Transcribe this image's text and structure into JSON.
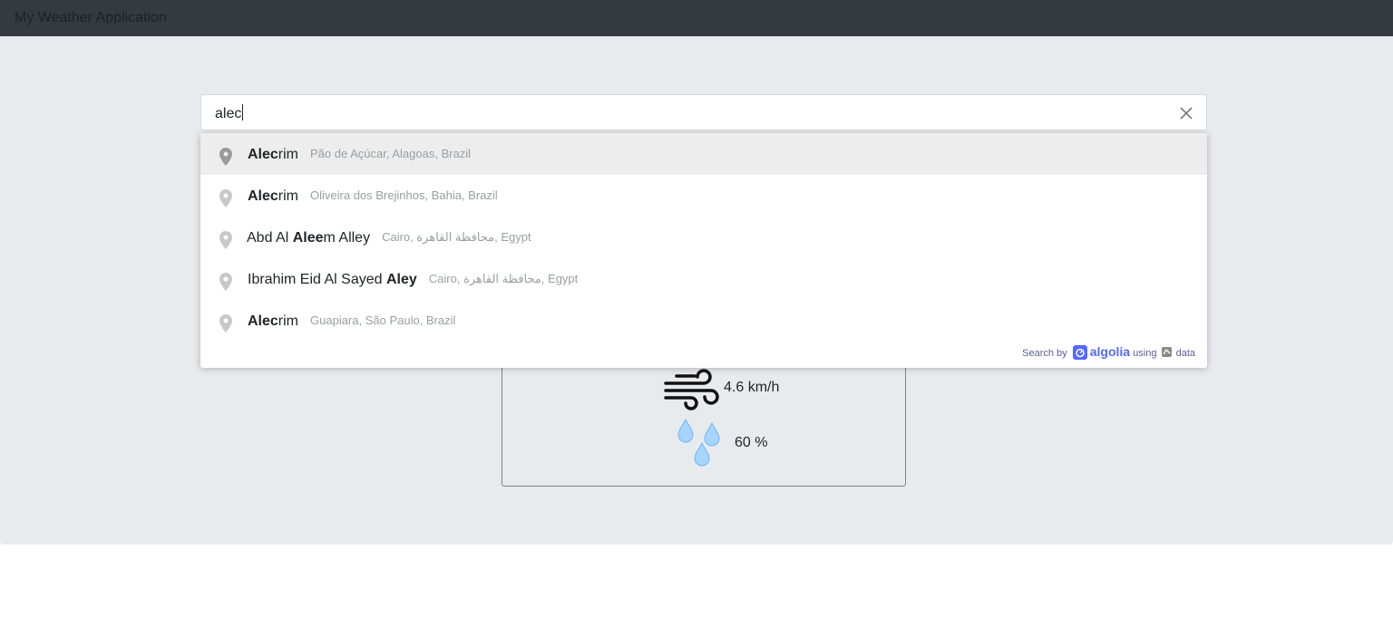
{
  "app": {
    "title": "My Weather Application"
  },
  "search": {
    "value": "alec"
  },
  "suggestions": [
    {
      "name_parts": [
        {
          "text": "Alec",
          "bold": true
        },
        {
          "text": "rim",
          "bold": false
        }
      ],
      "address": "Pão de Açúcar, Alagoas, Brazil",
      "active": true
    },
    {
      "name_parts": [
        {
          "text": "Alec",
          "bold": true
        },
        {
          "text": "rim",
          "bold": false
        }
      ],
      "address": "Oliveira dos Brejinhos, Bahia, Brazil",
      "active": false
    },
    {
      "name_parts": [
        {
          "text": "Abd Al ",
          "bold": false
        },
        {
          "text": "Alee",
          "bold": true
        },
        {
          "text": "m Alley",
          "bold": false
        }
      ],
      "address": "Cairo, محافظة القاهرة, Egypt",
      "active": false
    },
    {
      "name_parts": [
        {
          "text": "Ibrahim Eid Al Sayed ",
          "bold": false
        },
        {
          "text": "Aley",
          "bold": true
        }
      ],
      "address": "Cairo, محافظة القاهرة, Egypt",
      "active": false
    },
    {
      "name_parts": [
        {
          "text": "Alec",
          "bold": true
        },
        {
          "text": "rim",
          "bold": false
        }
      ],
      "address": "Guapiara, São Paulo, Brazil",
      "active": false
    }
  ],
  "attribution": {
    "prefix": "Search by",
    "brand": "algolia",
    "using": "using",
    "data": "data"
  },
  "weather": {
    "wind": "4.6 km/h",
    "humidity": "60 %"
  },
  "icons": {
    "pin": "map-pin-icon",
    "clear": "close-icon",
    "wind": "wind-icon",
    "drops": "water-drops-icon",
    "osm": "openstreetmap-icon",
    "algolia": "algolia-logo-icon"
  },
  "colors": {
    "navbar": "#343a40",
    "background": "#e8ebee",
    "algolia": "#5468ff",
    "drop": "#a8d4ff"
  }
}
